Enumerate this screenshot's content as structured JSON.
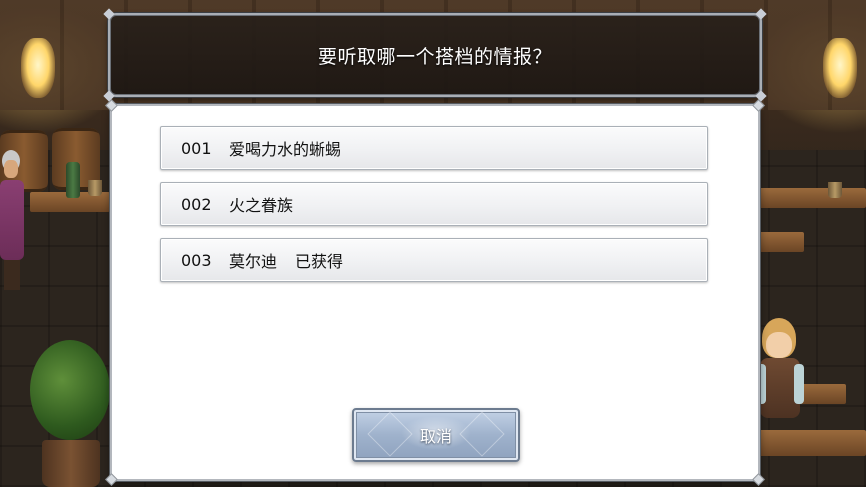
{
  "dialog": {
    "title": "要听取哪一个搭档的情报？"
  },
  "partners": [
    {
      "number": "001",
      "name": "爱喝力水的蜥蜴",
      "status": ""
    },
    {
      "number": "002",
      "name": "火之眷族",
      "status": ""
    },
    {
      "number": "003",
      "name": "莫尔迪",
      "status": "已获得"
    }
  ],
  "buttons": {
    "cancel_label": "取消"
  },
  "colors": {
    "panel_background": "#ffffff",
    "title_background": "#1f1915",
    "cancel_button": "#9fb2cc"
  }
}
